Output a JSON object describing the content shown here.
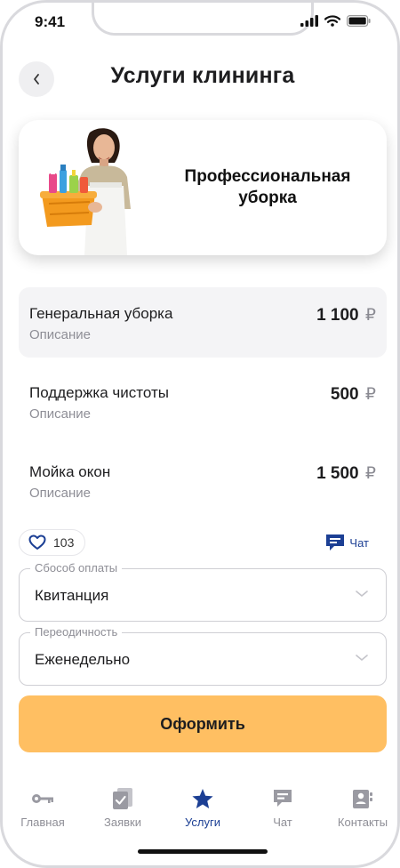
{
  "status_bar": {
    "time": "9:41"
  },
  "header": {
    "title": "Услуги клининга",
    "back_icon": "chevron-left-icon"
  },
  "hero": {
    "title": "Профессиональная уборка"
  },
  "services": [
    {
      "name": "Генеральная уборка",
      "description": "Описание",
      "price": "1 100",
      "currency": "₽",
      "active": true
    },
    {
      "name": "Поддержка чистоты",
      "description": "Описание",
      "price": "500",
      "currency": "₽",
      "active": false
    },
    {
      "name": "Мойка окон",
      "description": "Описание",
      "price": "1 500",
      "currency": "₽",
      "active": false
    }
  ],
  "actions": {
    "likes": "103",
    "chat_label": "Чат"
  },
  "payment": {
    "label": "Сбособ оплаты",
    "value": "Квитанция"
  },
  "frequency": {
    "label": "Переодичность",
    "value": "Еженедельно"
  },
  "submit": {
    "label": "Оформить"
  },
  "tabs": [
    {
      "label": "Главная",
      "icon": "key-icon",
      "active": false
    },
    {
      "label": "Заявки",
      "icon": "clipboard-check-icon",
      "active": false
    },
    {
      "label": "Услуги",
      "icon": "star-icon",
      "active": true
    },
    {
      "label": "Чат",
      "icon": "chat-icon",
      "active": false
    },
    {
      "label": "Контакты",
      "icon": "contacts-icon",
      "active": false
    }
  ],
  "colors": {
    "accent": "#1c3f94",
    "button": "#ffbf62",
    "muted": "#8e8e96"
  }
}
